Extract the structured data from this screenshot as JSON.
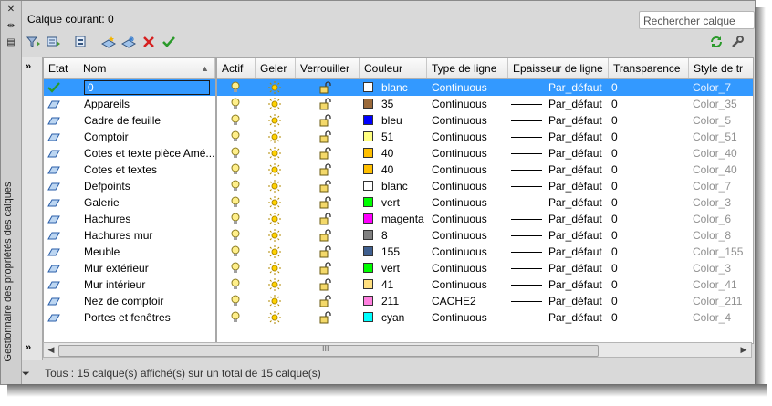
{
  "panel_title": "Gestionnaire des propriétés des calques",
  "current_layer_label": "Calque courant: 0",
  "search_placeholder": "Rechercher calque",
  "toolbar": {
    "icons": [
      "new-property-filter-icon",
      "new-group-filter-icon",
      "layer-states-manager-icon",
      "new-layer-icon",
      "new-layer-vp-frozen-icon",
      "delete-layer-icon",
      "set-current-icon",
      "refresh-icon",
      "settings-icon"
    ]
  },
  "columns": [
    "Etat",
    "Nom",
    "Actif",
    "Geler",
    "Verrouiller",
    "Couleur",
    "Type de ligne",
    "Epaisseur de ligne",
    "Transparence",
    "Style de tr"
  ],
  "rows": [
    {
      "name": "0",
      "color_name": "blanc",
      "color": "#ffffff",
      "linetype": "Continuous",
      "weight": "Par_défaut",
      "transparency": "0",
      "style": "Color_7"
    },
    {
      "name": "Appareils",
      "color_name": "35",
      "color": "#9b6a3a",
      "linetype": "Continuous",
      "weight": "Par_défaut",
      "transparency": "0",
      "style": "Color_35"
    },
    {
      "name": "Cadre de feuille",
      "color_name": "bleu",
      "color": "#0000ff",
      "linetype": "Continuous",
      "weight": "Par_défaut",
      "transparency": "0",
      "style": "Color_5"
    },
    {
      "name": "Comptoir",
      "color_name": "51",
      "color": "#ffff80",
      "linetype": "Continuous",
      "weight": "Par_défaut",
      "transparency": "0",
      "style": "Color_51"
    },
    {
      "name": "Cotes et texte pièce Amé...",
      "color_name": "40",
      "color": "#ffbf00",
      "linetype": "Continuous",
      "weight": "Par_défaut",
      "transparency": "0",
      "style": "Color_40"
    },
    {
      "name": "Cotes et textes",
      "color_name": "40",
      "color": "#ffbf00",
      "linetype": "Continuous",
      "weight": "Par_défaut",
      "transparency": "0",
      "style": "Color_40"
    },
    {
      "name": "Defpoints",
      "color_name": "blanc",
      "color": "#ffffff",
      "linetype": "Continuous",
      "weight": "Par_défaut",
      "transparency": "0",
      "style": "Color_7"
    },
    {
      "name": "Galerie",
      "color_name": "vert",
      "color": "#00ff00",
      "linetype": "Continuous",
      "weight": "Par_défaut",
      "transparency": "0",
      "style": "Color_3"
    },
    {
      "name": "Hachures",
      "color_name": "magenta",
      "color": "#ff00ff",
      "linetype": "Continuous",
      "weight": "Par_défaut",
      "transparency": "0",
      "style": "Color_6"
    },
    {
      "name": "Hachures mur",
      "color_name": "8",
      "color": "#808080",
      "linetype": "Continuous",
      "weight": "Par_défaut",
      "transparency": "0",
      "style": "Color_8"
    },
    {
      "name": "Meuble",
      "color_name": "155",
      "color": "#3f5f8f",
      "linetype": "Continuous",
      "weight": "Par_défaut",
      "transparency": "0",
      "style": "Color_155"
    },
    {
      "name": "Mur extérieur",
      "color_name": "vert",
      "color": "#00ff00",
      "linetype": "Continuous",
      "weight": "Par_défaut",
      "transparency": "0",
      "style": "Color_3"
    },
    {
      "name": "Mur intérieur",
      "color_name": "41",
      "color": "#ffdf7f",
      "linetype": "Continuous",
      "weight": "Par_défaut",
      "transparency": "0",
      "style": "Color_41"
    },
    {
      "name": "Nez de comptoir",
      "color_name": "211",
      "color": "#ff7fdf",
      "linetype": "CACHE2",
      "weight": "Par_défaut",
      "transparency": "0",
      "style": "Color_211"
    },
    {
      "name": "Portes et fenêtres",
      "color_name": "cyan",
      "color": "#00ffff",
      "linetype": "Continuous",
      "weight": "Par_défaut",
      "transparency": "0",
      "style": "Color_4"
    }
  ],
  "selected_row": 0,
  "status_text": "Tous : 15 calque(s) affiché(s) sur un total de 15 calque(s)",
  "scroll_grip": "III"
}
